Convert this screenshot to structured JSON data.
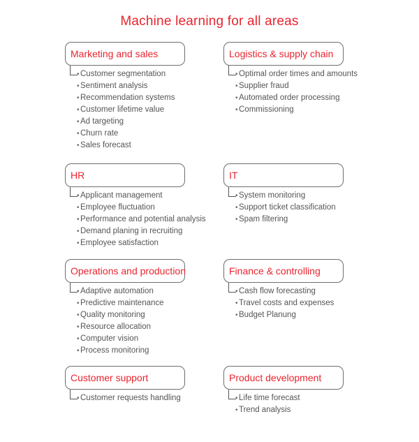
{
  "title": "Machine learning for all areas",
  "colors": {
    "accent": "#e8242f",
    "text": "#555555",
    "border": "#6e6e6e"
  },
  "groups": [
    {
      "label": "Marketing and sales",
      "items": [
        "Customer segmentation",
        "Sentiment analysis",
        "Recommendation systems",
        "Customer lifetime value",
        "Ad targeting",
        "Churn rate",
        "Sales forecast"
      ]
    },
    {
      "label": "Logistics & supply chain",
      "items": [
        "Optimal order times and amounts",
        "Supplier fraud",
        "Automated order processing",
        "Commissioning"
      ]
    },
    {
      "label": "HR",
      "items": [
        "Applicant management",
        "Employee fluctuation",
        "Performance and potential analysis",
        "Demand planing in recruiting",
        "Employee satisfaction"
      ]
    },
    {
      "label": "IT",
      "items": [
        "System monitoring",
        "Support ticket classification",
        "Spam filtering"
      ]
    },
    {
      "label": "Operations and production",
      "items": [
        "Adaptive automation",
        "Predictive maintenance",
        "Quality monitoring",
        "Resource allocation",
        "Computer vision",
        "Process monitoring"
      ]
    },
    {
      "label": "Finance & controlling",
      "items": [
        "Cash flow forecasting",
        "Travel costs and expenses",
        "Budget Planung"
      ]
    },
    {
      "label": "Customer support",
      "items": [
        "Customer requests handling"
      ]
    },
    {
      "label": "Product development",
      "items": [
        "Life time forecast",
        "Trend analysis"
      ]
    }
  ]
}
